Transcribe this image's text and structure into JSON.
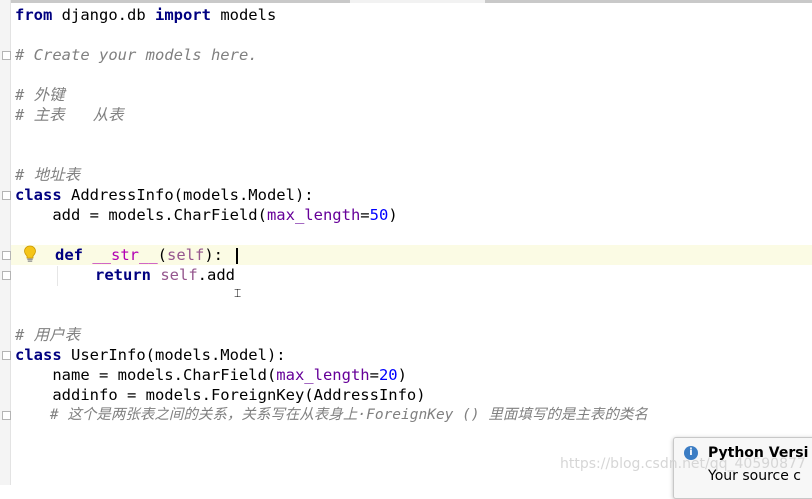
{
  "code": {
    "line1": {
      "kw1": "from",
      "t1": " django.db ",
      "kw2": "import",
      "t2": " models"
    },
    "line2": "# Create your models here.",
    "line3": "# 外键",
    "line4": "# 主表   从表",
    "line5": "# 地址表",
    "line6": {
      "kw": "class",
      "t": " AddressInfo(models.Model):"
    },
    "line7": {
      "t1": "    add = models.CharField(",
      "param": "max_length",
      "eq": "=",
      "num": "50",
      "t2": ")"
    },
    "line8": {
      "kw": "def",
      "sp": " ",
      "magic": "__str__",
      "p1": "(",
      "self": "self",
      "p2": "):"
    },
    "line9": {
      "kw": "return",
      "sp": " ",
      "self": "self",
      "t": ".add"
    },
    "line10": "# 用户表",
    "line11": {
      "kw": "class",
      "t": " UserInfo(models.Model):"
    },
    "line12": {
      "t1": "    name = models.CharField(",
      "param": "max_length",
      "eq": "=",
      "num": "20",
      "t2": ")"
    },
    "line13": "    addinfo = models.ForeignKey(AddressInfo)",
    "line14": "    # 这个是两张表之间的关系，关系写在从表身上·ForeignKey () 里面填写的是主表的类名"
  },
  "popup": {
    "title": "Python Versi",
    "subtitle": "Your source c"
  },
  "watermark": "https://blog.csdn.net/qq_40590877",
  "icons": {
    "intention": "lightbulb-icon",
    "info": "info-icon",
    "cursor": "text-cursor-icon"
  },
  "colors": {
    "keyword": "#000080",
    "comment": "#808080",
    "param": "#660099",
    "number": "#0000ff",
    "magic": "#b200b2",
    "self": "#94558d"
  }
}
